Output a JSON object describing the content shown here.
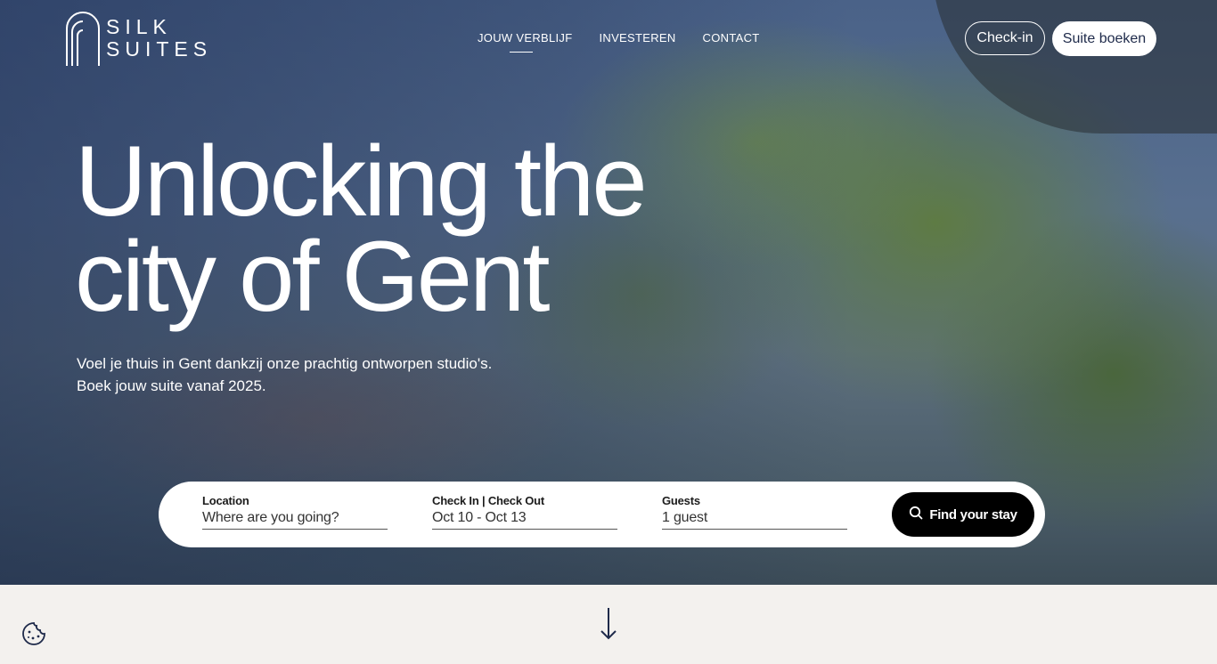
{
  "brand": {
    "line1": "SILK",
    "line2": "SUITES"
  },
  "nav": [
    {
      "label": "JOUW VERBLIJF"
    },
    {
      "label": "INVESTEREN"
    },
    {
      "label": "CONTACT"
    }
  ],
  "header": {
    "checkin_label": "Check-in",
    "book_label": "Suite boeken"
  },
  "hero": {
    "headline_line1": "Unlocking the",
    "headline_line2": "city of Gent",
    "sub_line1": "Voel je thuis in Gent dankzij onze prachtig ontworpen studio's.",
    "sub_line2": "Boek jouw suite vanaf 2025."
  },
  "search": {
    "location_label": "Location",
    "location_placeholder": "Where are you going?",
    "dates_label": "Check In | Check Out",
    "dates_value": "Oct 10 - Oct 13",
    "guests_label": "Guests",
    "guests_value": "1 guest",
    "button_label": "Find your stay"
  },
  "colors": {
    "accent": "#1e2a4a",
    "button": "#000000"
  },
  "icons": {
    "cookie": "cookie-icon",
    "scroll": "arrow-down-icon",
    "search": "search-icon"
  }
}
